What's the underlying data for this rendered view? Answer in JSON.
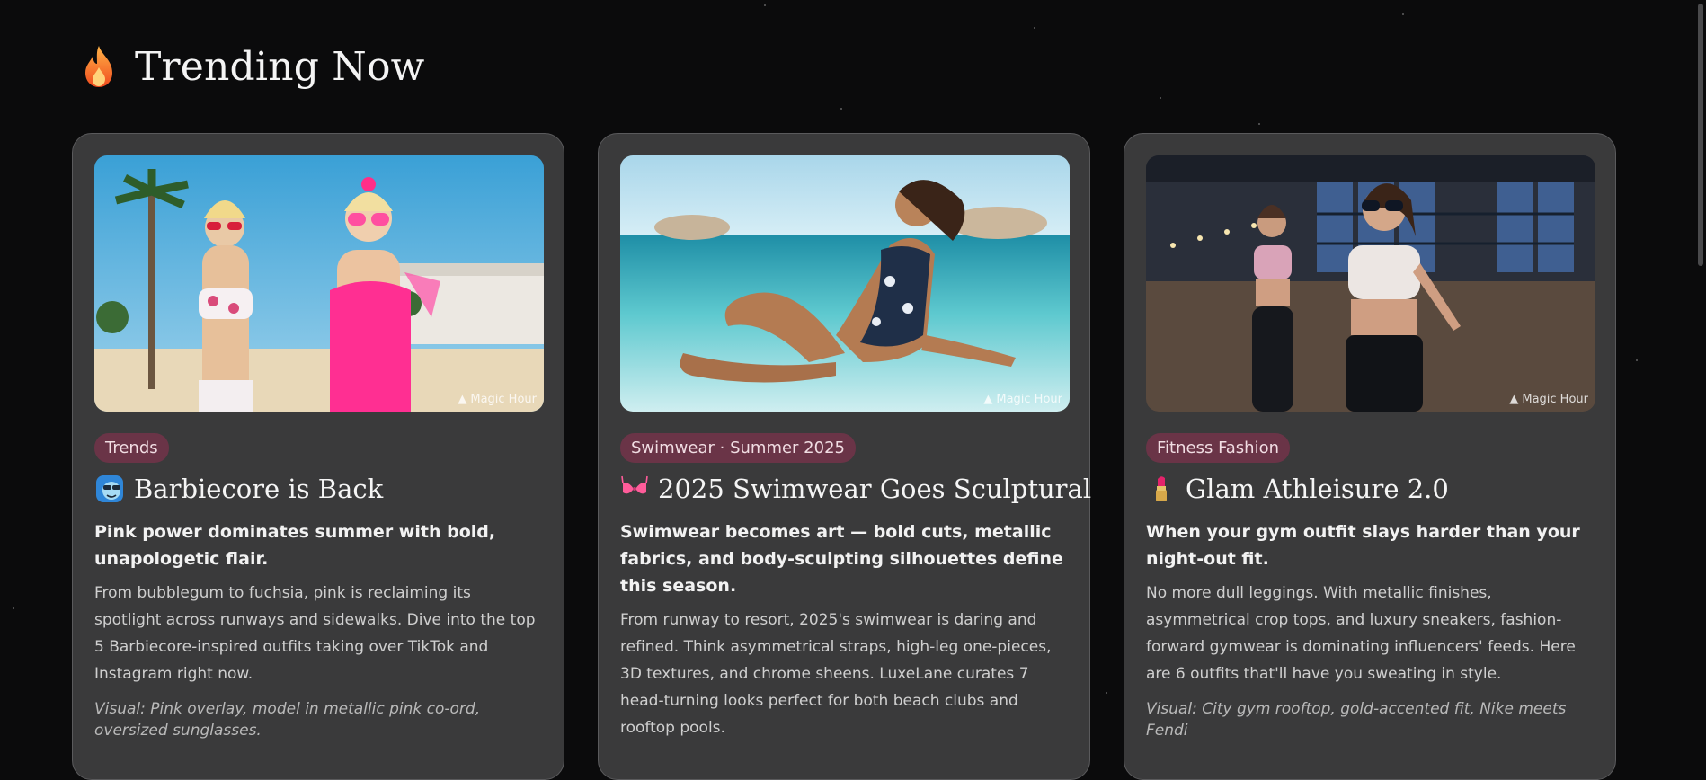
{
  "section": {
    "title": "Trending Now",
    "icon": "flame-icon"
  },
  "watermark": "Magic Hour",
  "cards": [
    {
      "tag": "Trends",
      "title_icon": "sunglasses-face-icon",
      "title": "Barbiecore is Back",
      "subtitle": "Pink power dominates summer with bold, unapologetic flair.",
      "body": "From bubblegum to fuchsia, pink is reclaiming its spotlight across runways and sidewalks. Dive into the top 5 Barbiecore-inspired outfits taking over TikTok and Instagram right now.",
      "visual": "Visual: Pink overlay, model in metallic pink co-ord, oversized sunglasses."
    },
    {
      "tag": "Swimwear · Summer 2025",
      "title_icon": "bikini-top-icon",
      "title": "2025 Swimwear Goes Sculptural",
      "subtitle": "Swimwear becomes art — bold cuts, metallic fabrics, and body-sculpting silhouettes define this season.",
      "body": "From runway to resort, 2025's swimwear is daring and refined. Think asymmetrical straps, high-leg one-pieces, 3D textures, and chrome sheens. LuxeLane curates 7 head-turning looks perfect for both beach clubs and rooftop pools.",
      "visual": ""
    },
    {
      "tag": "Fitness Fashion",
      "title_icon": "lipstick-icon",
      "title": "Glam Athleisure 2.0",
      "subtitle": "When your gym outfit slays harder than your night-out fit.",
      "body": "No more dull leggings. With metallic finishes, asymmetrical crop tops, and luxury sneakers, fashion-forward gymwear is dominating influencers' feeds. Here are 6 outfits that'll have you sweating in style.",
      "visual": "Visual: City gym rooftop, gold-accented fit, Nike meets Fendi"
    }
  ],
  "colors": {
    "background": "#0b0b0c",
    "card": "#3a3a3b",
    "tag_bg": "#6a3447",
    "tag_text": "#f1dde3"
  }
}
